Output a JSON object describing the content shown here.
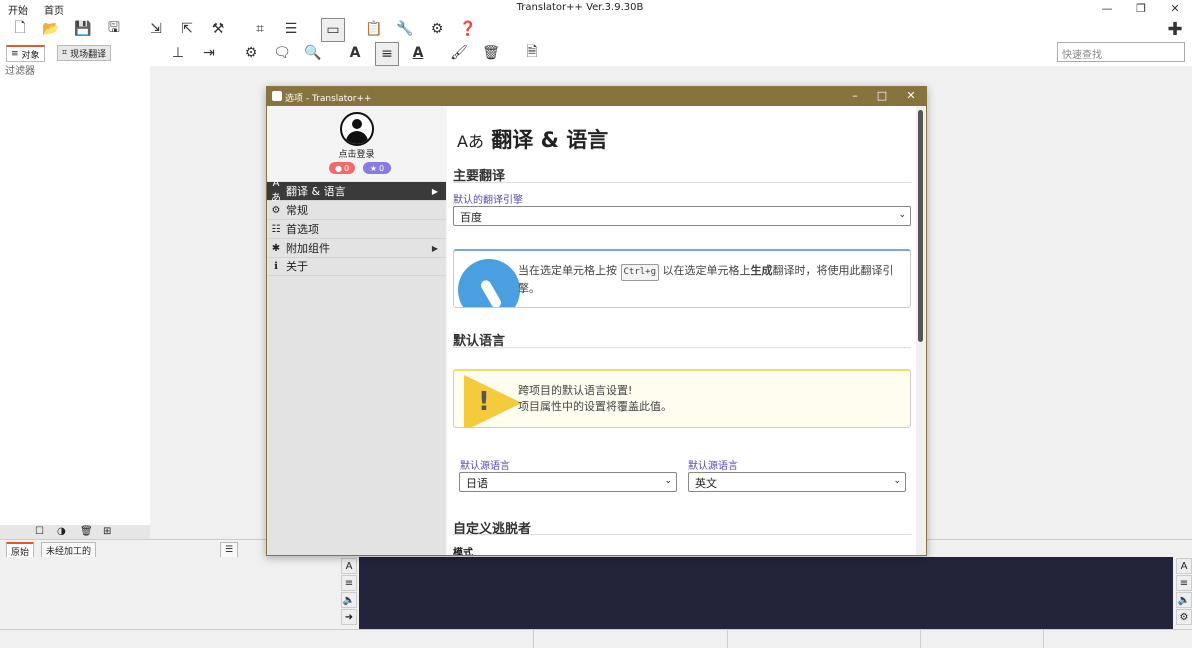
{
  "menubar": {
    "start": "开始",
    "home": "首页"
  },
  "window": {
    "title": "Translator++ Ver.3.9.30B"
  },
  "left_panel": {
    "tabs": [
      "对象",
      "现场翻译"
    ],
    "filter_label": "过滤器"
  },
  "search": {
    "placeholder": "快速查找"
  },
  "bottom_tabs": [
    "原始",
    "未经加工的"
  ],
  "dialog": {
    "title": "选项 - Translator++",
    "profile": {
      "login": "点击登录",
      "badge_red": "0",
      "badge_purple": "0"
    },
    "nav": [
      {
        "label": "翻译 & 语言",
        "icon": "Aあ",
        "has_submenu": true,
        "selected": true
      },
      {
        "label": "常规",
        "icon": "gear",
        "has_submenu": false
      },
      {
        "label": "首选项",
        "icon": "prefs",
        "has_submenu": false
      },
      {
        "label": "附加组件",
        "icon": "puzzle",
        "has_submenu": true
      },
      {
        "label": "关于",
        "icon": "info",
        "has_submenu": false
      }
    ],
    "content": {
      "title_icon": "Aあ",
      "title": "翻译 & 语言",
      "section_main": "主要翻译",
      "engine_label": "默认的翻译引擎",
      "engine_value": "百度",
      "info_pre": "当在选定单元格上按",
      "info_kbd": "Ctrl+g",
      "info_mid": "以在选定单元格上",
      "info_bold": "生成",
      "info_post": "翻译时，将使用此翻译引擎。",
      "section_lang": "默认语言",
      "warn_line1": "跨项目的默认语言设置!",
      "warn_line2": "项目属性中的设置将覆盖此值。",
      "src_label": "默认源语言",
      "src_value": "日语",
      "tgt_label": "默认源语言",
      "tgt_value": "英文",
      "section_escaper": "自定义逃脱者",
      "mode_label": "模式"
    }
  },
  "colors": {
    "dialog_title": "#86733d",
    "accent_tab": "#e05a2a",
    "info_blue": "#4a9fe0",
    "warn_yellow": "#f3cb3c",
    "dark_pane": "#23233a"
  }
}
